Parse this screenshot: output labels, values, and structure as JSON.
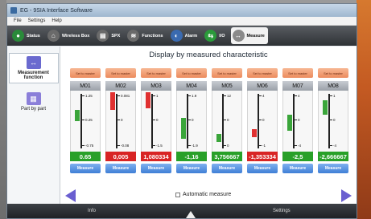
{
  "window": {
    "title": "EG - 9SIA Interface Software"
  },
  "menu": [
    "File",
    "Settings",
    "Help"
  ],
  "toolbar": [
    {
      "label": "Status",
      "icon": "status-icon",
      "color": "#2a8a3a"
    },
    {
      "label": "Wireless Box",
      "icon": "wireless-box-icon",
      "color": "#6a6a6a"
    },
    {
      "label": "SPX",
      "icon": "spx-icon",
      "color": "#6a6a6a"
    },
    {
      "label": "Functions",
      "icon": "functions-icon",
      "color": "#6a6a6a"
    },
    {
      "label": "Alarm",
      "icon": "alarm-icon",
      "color": "#3a6ab0"
    },
    {
      "label": "I/O",
      "icon": "io-icon",
      "color": "#2a9a3a"
    },
    {
      "label": "Measure",
      "icon": "measure-icon",
      "color": "#8a8a8a",
      "active": true
    }
  ],
  "sidebar": {
    "items": [
      {
        "label": "Measurement function",
        "icon": "measurement-function-icon",
        "active": true
      },
      {
        "label": "Part by part",
        "icon": "part-by-part-icon",
        "active": false
      }
    ]
  },
  "main": {
    "title": "Display by measured characteristic",
    "set_label": "Set to master",
    "measure_label": "Measure",
    "automatic_measure_label": "Automatic measure",
    "columns": [
      {
        "name": "M01",
        "value": "0.65",
        "ticks": [
          "1.25",
          "0.25",
          "-0.75"
        ],
        "bar_color": "#3aa53a",
        "value_color": "#28a028"
      },
      {
        "name": "M02",
        "value": "0,005",
        "ticks": [
          "0.081",
          "0",
          "-0.08"
        ],
        "bar_color": "#e03030",
        "value_color": "#d82424"
      },
      {
        "name": "M03",
        "value": "1,080334",
        "ticks": [
          "1",
          "0",
          "-1.5"
        ],
        "bar_color": "#e03030",
        "value_color": "#d82424"
      },
      {
        "name": "M04",
        "value": "-1,16",
        "ticks": [
          "1.9",
          "0",
          "-1.9"
        ],
        "bar_color": "#3aa53a",
        "value_color": "#28a028"
      },
      {
        "name": "M05",
        "value": "3,756667",
        "ticks": [
          "12",
          "0",
          "0"
        ],
        "bar_color": "#3aa53a",
        "value_color": "#28a028"
      },
      {
        "name": "M06",
        "value": "-1,353334",
        "ticks": [
          "4",
          "0",
          "-1"
        ],
        "bar_color": "#e03030",
        "value_color": "#d82424"
      },
      {
        "name": "M07",
        "value": "-2,5",
        "ticks": [
          "4",
          "0",
          "-4"
        ],
        "bar_color": "#3aa53a",
        "value_color": "#28a028"
      },
      {
        "name": "M08",
        "value": "-2,666667",
        "ticks": [
          "1",
          "0",
          "-4"
        ],
        "bar_color": "#3aa53a",
        "value_color": "#28a028"
      }
    ]
  },
  "statusbar": {
    "left": "Info",
    "right": "Settings"
  }
}
